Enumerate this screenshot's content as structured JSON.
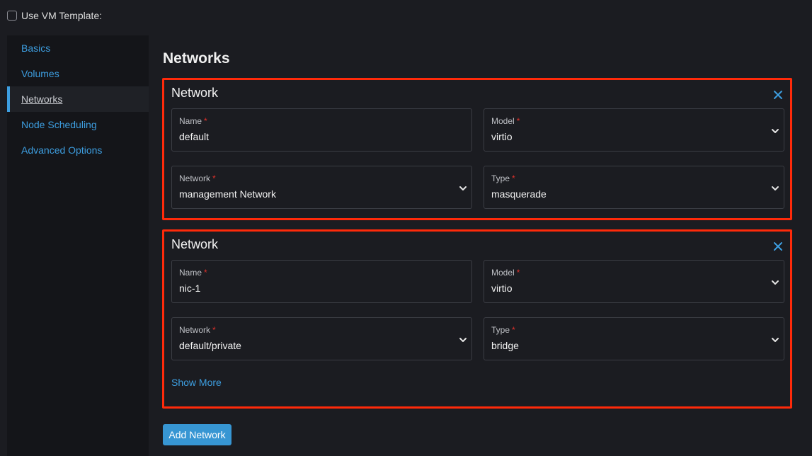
{
  "template": {
    "label": "Use VM Template:",
    "checked": false
  },
  "sidebar": {
    "items": [
      {
        "label": "Basics"
      },
      {
        "label": "Volumes"
      },
      {
        "label": "Networks"
      },
      {
        "label": "Node Scheduling"
      },
      {
        "label": "Advanced Options"
      }
    ],
    "active": "Networks"
  },
  "main": {
    "title": "Networks",
    "networks": [
      {
        "title": "Network",
        "name": {
          "label": "Name",
          "value": "default"
        },
        "model": {
          "label": "Model",
          "value": "virtio"
        },
        "network": {
          "label": "Network",
          "value": "management Network"
        },
        "type": {
          "label": "Type",
          "value": "masquerade"
        }
      },
      {
        "title": "Network",
        "name": {
          "label": "Name",
          "value": "nic-1"
        },
        "model": {
          "label": "Model",
          "value": "virtio"
        },
        "network": {
          "label": "Network",
          "value": "default/private"
        },
        "type": {
          "label": "Type",
          "value": "bridge"
        },
        "show_more": "Show More"
      }
    ],
    "required_marker": "*",
    "add_button": "Add Network"
  },
  "icons": {
    "close": "close-icon",
    "dropdown": "chevron-down-icon"
  },
  "colors": {
    "accent": "#3d9ee0",
    "highlight": "#ff2a0a",
    "required": "#e0312b",
    "button": "#3796d3"
  }
}
